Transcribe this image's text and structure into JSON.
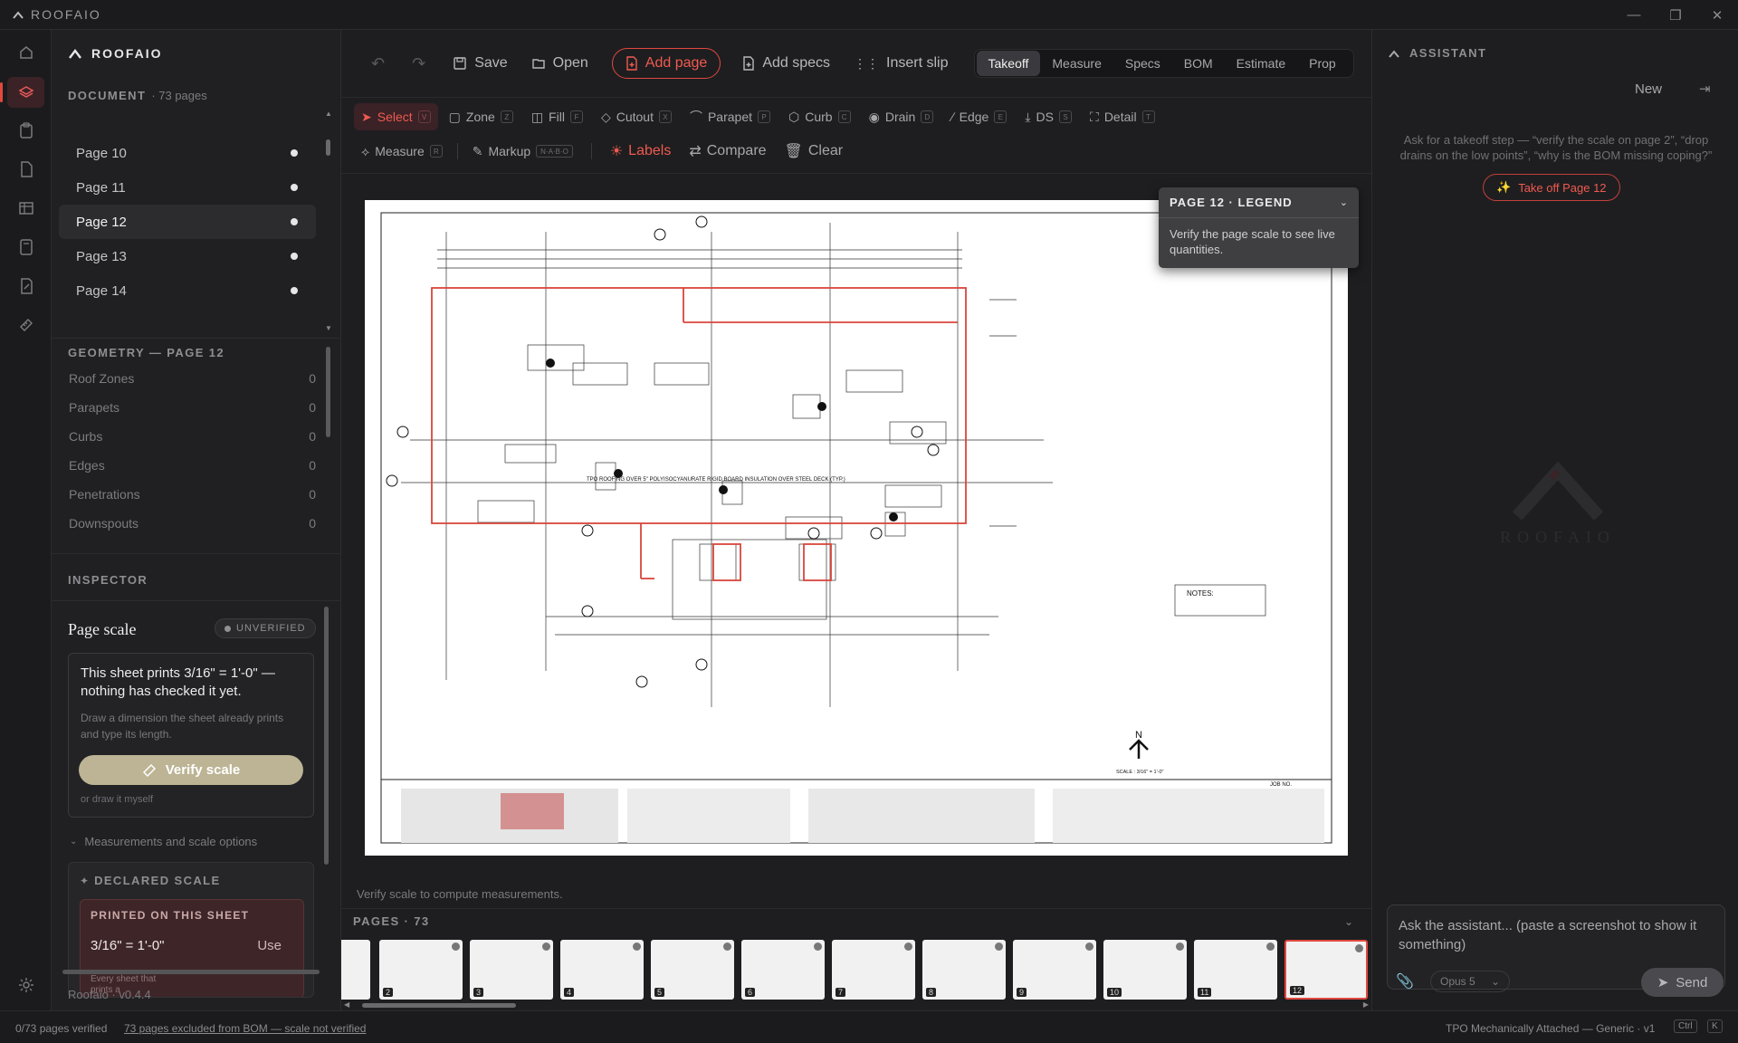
{
  "app": {
    "title": "ROOFAIO"
  },
  "sidebar": {
    "title": "ROOFAIO",
    "document": {
      "heading": "DOCUMENT",
      "count": "· 73 pages",
      "pages": [
        {
          "label": "Page 10"
        },
        {
          "label": "Page 11"
        },
        {
          "label": "Page 12"
        },
        {
          "label": "Page 13"
        },
        {
          "label": "Page 14"
        }
      ]
    },
    "geometry": {
      "heading": "GEOMETRY — PAGE 12",
      "rows": [
        {
          "label": "Roof Zones",
          "count": "0"
        },
        {
          "label": "Parapets",
          "count": "0"
        },
        {
          "label": "Curbs",
          "count": "0"
        },
        {
          "label": "Edges",
          "count": "0"
        },
        {
          "label": "Penetrations",
          "count": "0"
        },
        {
          "label": "Downspouts",
          "count": "0"
        }
      ]
    },
    "inspector": {
      "heading": "INSPECTOR",
      "title": "Page scale",
      "badge": "UNVERIFIED",
      "message": "This sheet prints 3/16\" = 1'-0\" — nothing has checked it yet.",
      "hint": "Draw a dimension the sheet already prints and type its length.",
      "verify_button": "Verify scale",
      "draw_link": "or draw it myself",
      "options_label": "Measurements and scale options",
      "declared_heading": "DECLARED SCALE",
      "printed_heading": "PRINTED ON THIS SHEET",
      "printed_value": "3/16\" = 1'-0\"",
      "use_button": "Use",
      "fade_text": "Every sheet that prints a"
    },
    "version": "Roofaio · v0.4.4"
  },
  "toolbar": {
    "save": "Save",
    "open": "Open",
    "add_page": "Add page",
    "add_specs": "Add specs",
    "insert_slip": "Insert slip",
    "tabs": [
      {
        "label": "Takeoff",
        "active": true
      },
      {
        "label": "Measure"
      },
      {
        "label": "Specs"
      },
      {
        "label": "BOM"
      },
      {
        "label": "Estimate"
      },
      {
        "label": "Prop"
      }
    ]
  },
  "tools": {
    "row1": [
      {
        "label": "Select",
        "key": "V"
      },
      {
        "label": "Zone",
        "key": "Z"
      },
      {
        "label": "Fill",
        "key": "F"
      },
      {
        "label": "Cutout",
        "key": "X"
      },
      {
        "label": "Parapet",
        "key": "P"
      },
      {
        "label": "Curb",
        "key": "C"
      },
      {
        "label": "Drain",
        "key": "D"
      },
      {
        "label": "Edge",
        "key": "E"
      },
      {
        "label": "DS",
        "key": "S"
      },
      {
        "label": "Detail",
        "key": "T"
      }
    ],
    "measure": "Measure",
    "measure_key": "R",
    "markup": "Markup",
    "markup_keys": "N·A·B·O",
    "labels": "Labels",
    "compare": "Compare",
    "clear": "Clear"
  },
  "legend": {
    "title": "PAGE 12 · LEGEND",
    "text": "Verify the page scale to see live quantities."
  },
  "canvas": {
    "notes": "NOTES:",
    "north": "N",
    "scale_text": "SCALE : 3/16\" = 1'-0\"",
    "job_no": "JOB NO.",
    "tpo_note": "TPO ROOFING OVER 5\" POLYISOCYANURATE RIGID BOARD INSULATION OVER STEEL DECK (TYP.)",
    "verify_hint": "Verify scale to compute measurements."
  },
  "pages_strip": {
    "heading": "PAGES · 73",
    "thumbs": [
      "2",
      "3",
      "4",
      "5",
      "6",
      "7",
      "8",
      "9",
      "10",
      "11",
      "12"
    ]
  },
  "assistant": {
    "heading": "ASSISTANT",
    "new_label": "New",
    "intro": "Ask for a takeoff step — “verify the scale on page 2”, “drop drains on the low points”, “why is the BOM missing coping?”",
    "take_off": "Take off Page 12",
    "watermark": "ROOFAIO",
    "placeholder": "Ask the assistant... (paste a screenshot to show it something)",
    "model": "Opus 5",
    "send": "Send"
  },
  "status": {
    "verified": "0/73 pages verified",
    "excluded": "73 pages excluded from BOM — scale not verified",
    "system": "TPO Mechanically Attached — Generic · v1",
    "shortcut": "Ctrl",
    "shortcut2": "K"
  },
  "colors": {
    "accent": "#e2483f",
    "bg": "#1f1f21",
    "verify_btn": "#bcb494",
    "plan_red": "#d9463c"
  }
}
